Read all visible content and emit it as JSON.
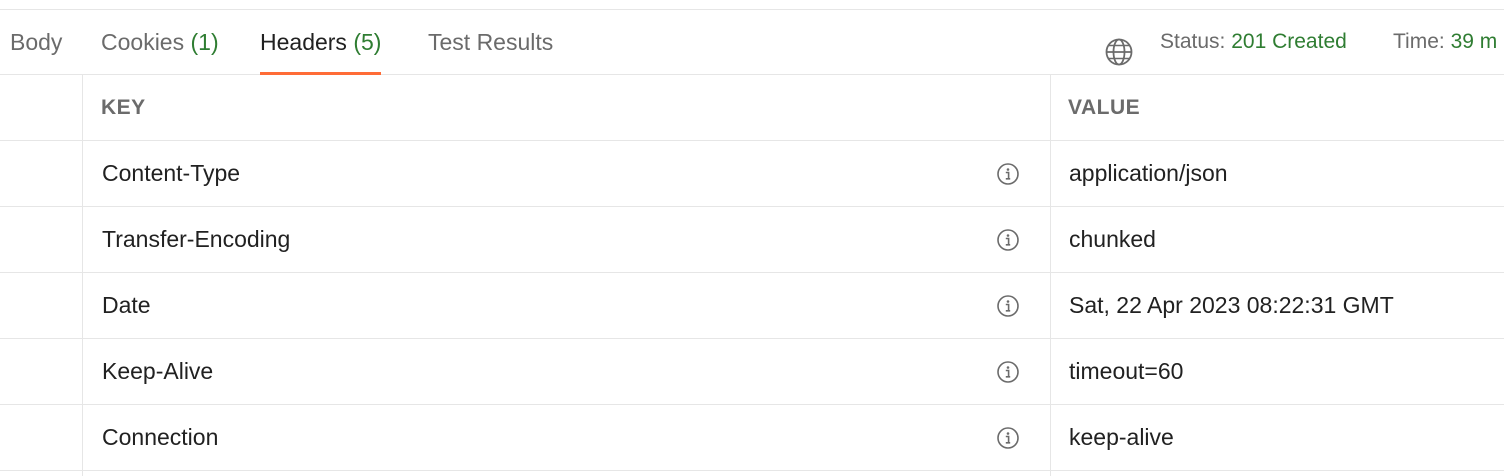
{
  "tabs": [
    {
      "label": "Body",
      "count": ""
    },
    {
      "label": "Cookies",
      "count": "(1)"
    },
    {
      "label": "Headers",
      "count": "(5)"
    },
    {
      "label": "Test Results",
      "count": ""
    }
  ],
  "active_tab": "Headers",
  "status": {
    "status_label": "Status:",
    "status_value": "201 Created",
    "time_label": "Time:",
    "time_value": "39 m"
  },
  "table": {
    "columns": {
      "key": "KEY",
      "value": "VALUE"
    },
    "rows": [
      {
        "key": "Content-Type",
        "value": "application/json"
      },
      {
        "key": "Transfer-Encoding",
        "value": "chunked"
      },
      {
        "key": "Date",
        "value": "Sat, 22 Apr 2023 08:22:31 GMT"
      },
      {
        "key": "Keep-Alive",
        "value": "timeout=60"
      },
      {
        "key": "Connection",
        "value": "keep-alive"
      }
    ]
  },
  "icons": {
    "globe": "globe-icon",
    "info": "info-icon"
  },
  "colors": {
    "accent": "#ff6c37",
    "success": "#2f7d32",
    "muted_text": "#6b6b6b",
    "border": "#e6e6e6"
  }
}
